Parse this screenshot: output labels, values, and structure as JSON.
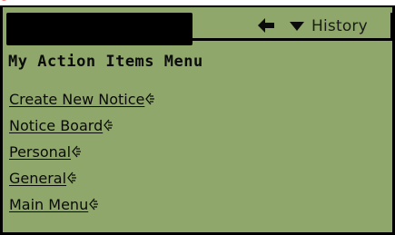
{
  "header": {
    "history_label": "History"
  },
  "main": {
    "page_title": "My Action Items Menu",
    "menu_items": [
      {
        "label": "Create New Notice"
      },
      {
        "label": "Notice Board"
      },
      {
        "label": "Personal"
      },
      {
        "label": "General"
      },
      {
        "label": "Main Menu"
      }
    ]
  },
  "icons": {
    "back": "back-arrow-icon",
    "history_dropdown": "chevron-down-icon",
    "link_marker": "link-glyph-icon"
  },
  "colors": {
    "screen_background": "#8fa76a",
    "frame": "#000000",
    "text": "#0a0a0a",
    "corner_mark": "#e00000"
  }
}
